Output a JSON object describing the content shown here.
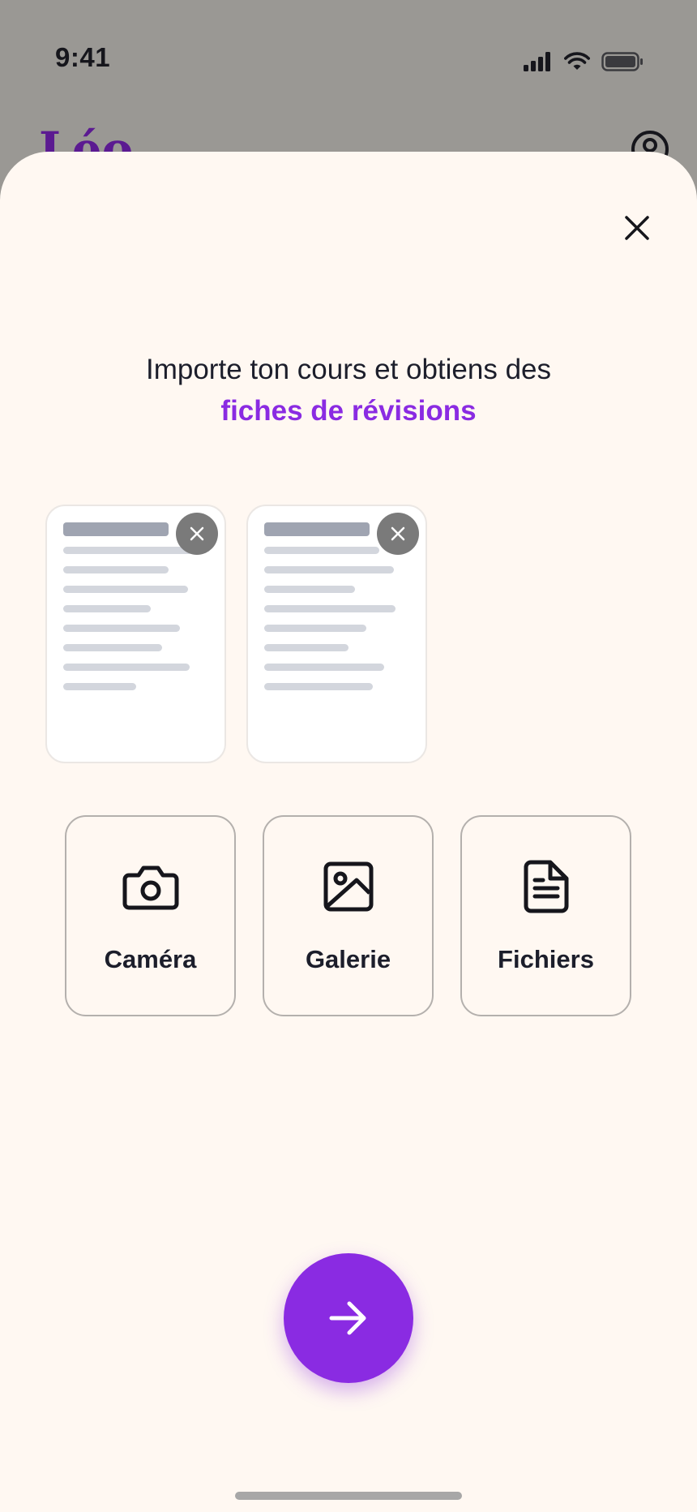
{
  "status_bar": {
    "time": "9:41",
    "icons": [
      "cellular-signal-icon",
      "wifi-icon",
      "battery-icon"
    ]
  },
  "background_app": {
    "logo_text": "Léo",
    "profile_icon": "user-circle-icon"
  },
  "sheet": {
    "close_icon": "close-icon",
    "headline": {
      "line1": "Importe ton cours et obtiens des",
      "line2": "fiches de révisions"
    },
    "documents": [
      {
        "remove_icon": "close-icon"
      },
      {
        "remove_icon": "close-icon"
      }
    ],
    "sources": [
      {
        "label": "Caméra",
        "icon": "camera-icon"
      },
      {
        "label": "Galerie",
        "icon": "image-icon"
      },
      {
        "label": "Fichiers",
        "icon": "file-text-icon"
      }
    ],
    "next_icon": "arrow-right-icon"
  },
  "colors": {
    "accent": "#8a2be2",
    "sheet_background": "#fff8f2",
    "text_dark": "#1c1e2b",
    "overlay": "#9a9894"
  }
}
